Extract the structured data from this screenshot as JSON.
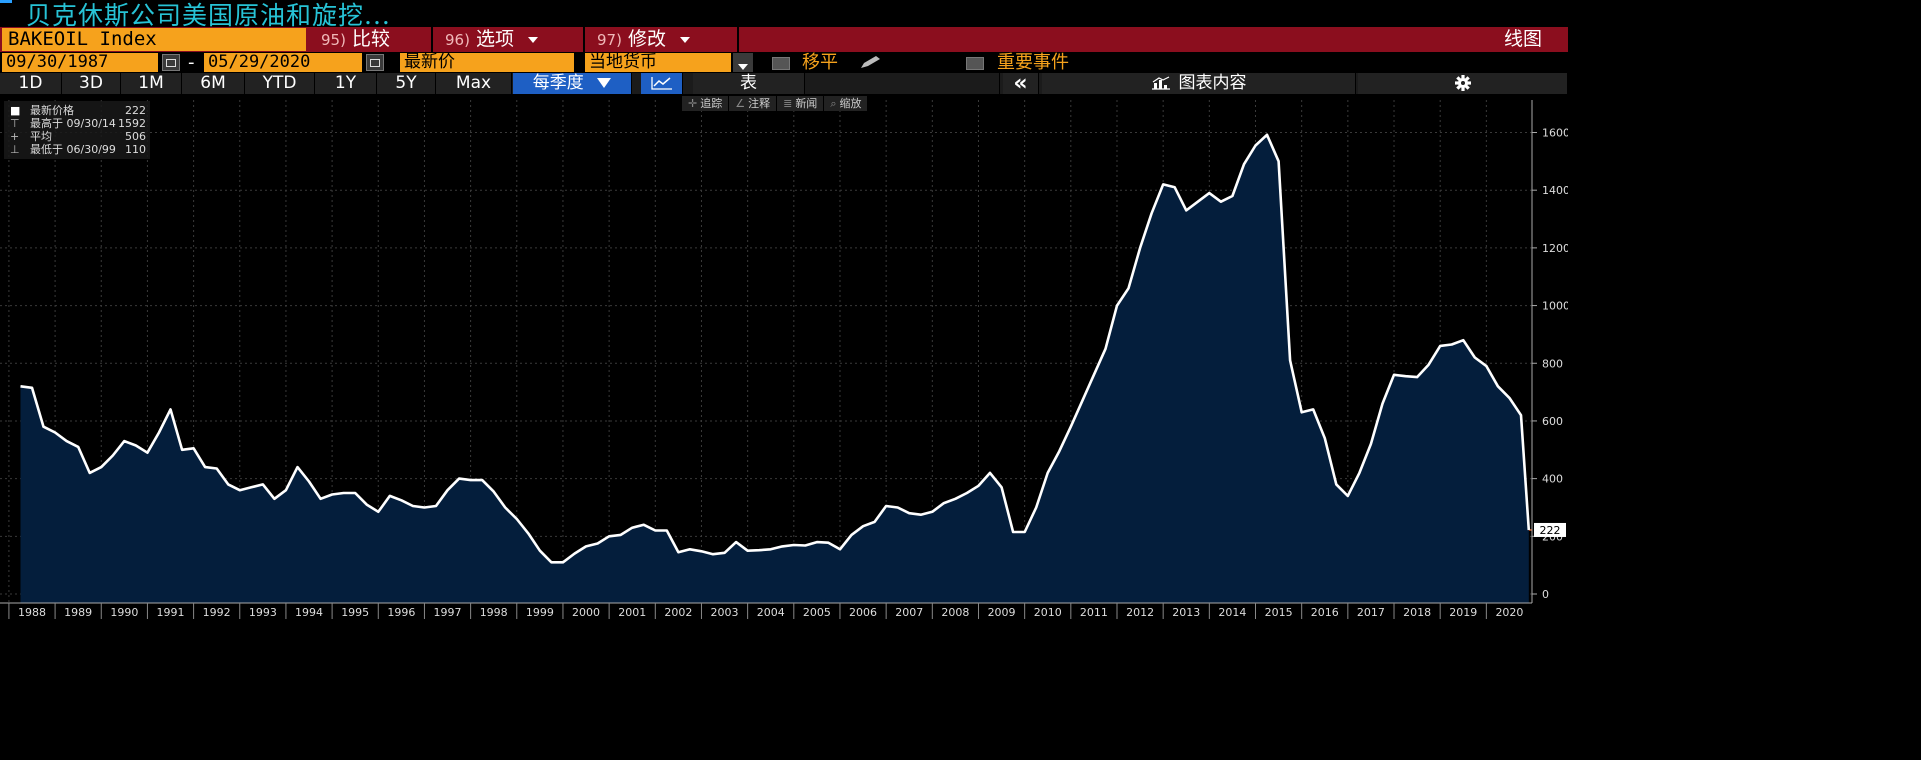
{
  "title": "贝克休斯公司美国原油和旋挖...",
  "colors": {
    "accent_orange": "#f6a21c",
    "header_red": "#8b0e1e",
    "title_cyan": "#27c3d6",
    "active_blue": "#1e5fc4",
    "area_fill": "#041e3c",
    "line": "#ffffff",
    "last_price_line": "#e0622a"
  },
  "toolbar": {
    "ticker": "BAKEOIL Index",
    "compare": {
      "num": "95)",
      "label": "比较"
    },
    "options": {
      "num": "96)",
      "label": "选项"
    },
    "modify": {
      "num": "97)",
      "label": "修改"
    },
    "chart_type": "线图"
  },
  "params": {
    "start_date": "09/30/1987",
    "dash": "-",
    "end_date": "05/29/2020",
    "field": "最新价",
    "currency": "当地货币",
    "moving_avg": "移平",
    "events": "重要事件"
  },
  "ranges": [
    "1D",
    "3D",
    "1M",
    "6M",
    "YTD",
    "1Y",
    "5Y",
    "Max"
  ],
  "period": "每季度",
  "table_label": "表",
  "collapse_icon": "«",
  "chart_content_label": "图表内容",
  "settings_icon": "gear-icon",
  "legend": [
    {
      "label": "最新价格",
      "value": "222",
      "sym": "■"
    },
    {
      "label": "最高于 09/30/14",
      "value": "1592",
      "sym": "⊤"
    },
    {
      "label": "平均",
      "value": "506",
      "sym": "+"
    },
    {
      "label": "最低于 06/30/99",
      "value": "110",
      "sym": "⊥"
    }
  ],
  "mini_tools": [
    {
      "icon": "crosshair-icon",
      "glyph": "✛",
      "label": "追踪"
    },
    {
      "icon": "pencil-icon",
      "glyph": "∠",
      "label": "注释"
    },
    {
      "icon": "news-icon",
      "glyph": "≣",
      "label": "新闻"
    },
    {
      "icon": "zoom-icon",
      "glyph": "⌕",
      "label": "缩放"
    }
  ],
  "chart_data": {
    "type": "area",
    "ylim": [
      0,
      1700
    ],
    "yticks": [
      0,
      200,
      400,
      600,
      800,
      1000,
      1200,
      1400,
      1600
    ],
    "xlim": [
      1987.75,
      2020.5
    ],
    "xticks": [
      "1988",
      "1989",
      "1990",
      "1991",
      "1992",
      "1993",
      "1994",
      "1995",
      "1996",
      "1997",
      "1998",
      "1999",
      "2000",
      "2001",
      "2002",
      "2003",
      "2004",
      "2005",
      "2006",
      "2007",
      "2008",
      "2009",
      "2010",
      "2011",
      "2012",
      "2013",
      "2014",
      "2015",
      "2016",
      "2017",
      "2018",
      "2019",
      "2020"
    ],
    "last_value_label": "222",
    "grid": true,
    "series": [
      {
        "x": [
          1987.75,
          1988.0,
          1988.25,
          1988.5,
          1988.75,
          1989.0,
          1989.25,
          1989.5,
          1989.75,
          1990.0,
          1990.25,
          1990.5,
          1990.75,
          1991.0,
          1991.25,
          1991.5,
          1991.75,
          1992.0,
          1992.25,
          1992.5,
          1992.75,
          1993.0,
          1993.25,
          1993.5,
          1993.75,
          1994.0,
          1994.25,
          1994.5,
          1994.75,
          1995.0,
          1995.25,
          1995.5,
          1995.75,
          1996.0,
          1996.25,
          1996.5,
          1996.75,
          1997.0,
          1997.25,
          1997.5,
          1997.75,
          1998.0,
          1998.25,
          1998.5,
          1998.75,
          1999.0,
          1999.25,
          1999.5,
          1999.75,
          2000.0,
          2000.25,
          2000.5,
          2000.75,
          2001.0,
          2001.25,
          2001.5,
          2001.75,
          2002.0,
          2002.25,
          2002.5,
          2002.75,
          2003.0,
          2003.25,
          2003.5,
          2003.75,
          2004.0,
          2004.25,
          2004.5,
          2004.75,
          2005.0,
          2005.25,
          2005.5,
          2005.75,
          2006.0,
          2006.25,
          2006.5,
          2006.75,
          2007.0,
          2007.25,
          2007.5,
          2007.75,
          2008.0,
          2008.25,
          2008.5,
          2008.75,
          2009.0,
          2009.25,
          2009.5,
          2009.75,
          2010.0,
          2010.25,
          2010.5,
          2010.75,
          2011.0,
          2011.25,
          2011.5,
          2011.75,
          2012.0,
          2012.25,
          2012.5,
          2012.75,
          2013.0,
          2013.25,
          2013.5,
          2013.75,
          2014.0,
          2014.25,
          2014.5,
          2014.75,
          2015.0,
          2015.25,
          2015.5,
          2015.75,
          2016.0,
          2016.25,
          2016.5,
          2016.75,
          2017.0,
          2017.25,
          2017.5,
          2017.75,
          2018.0,
          2018.25,
          2018.5,
          2018.75,
          2019.0,
          2019.25,
          2019.5,
          2019.75,
          2020.0,
          2020.25,
          2020.42
        ],
        "y": [
          720,
          715,
          580,
          560,
          530,
          510,
          420,
          440,
          480,
          530,
          515,
          490,
          560,
          640,
          500,
          505,
          440,
          435,
          380,
          360,
          370,
          380,
          330,
          360,
          440,
          390,
          330,
          345,
          350,
          350,
          310,
          285,
          340,
          325,
          305,
          300,
          305,
          360,
          400,
          395,
          395,
          355,
          300,
          260,
          210,
          150,
          110,
          110,
          140,
          165,
          175,
          200,
          205,
          230,
          240,
          220,
          220,
          145,
          155,
          148,
          138,
          143,
          180,
          150,
          152,
          155,
          165,
          170,
          168,
          180,
          178,
          155,
          205,
          235,
          250,
          305,
          300,
          280,
          275,
          285,
          315,
          330,
          350,
          375,
          420,
          370,
          215,
          215,
          300,
          420,
          495,
          580,
          670,
          760,
          850,
          1000,
          1060,
          1200,
          1320,
          1420,
          1410,
          1330,
          1360,
          1390,
          1360,
          1380,
          1490,
          1555,
          1592,
          1500,
          810,
          630,
          640,
          540,
          380,
          340,
          420,
          520,
          660,
          760,
          755,
          752,
          795,
          860,
          865,
          880,
          820,
          790,
          720,
          680,
          620,
          222
        ]
      }
    ]
  }
}
